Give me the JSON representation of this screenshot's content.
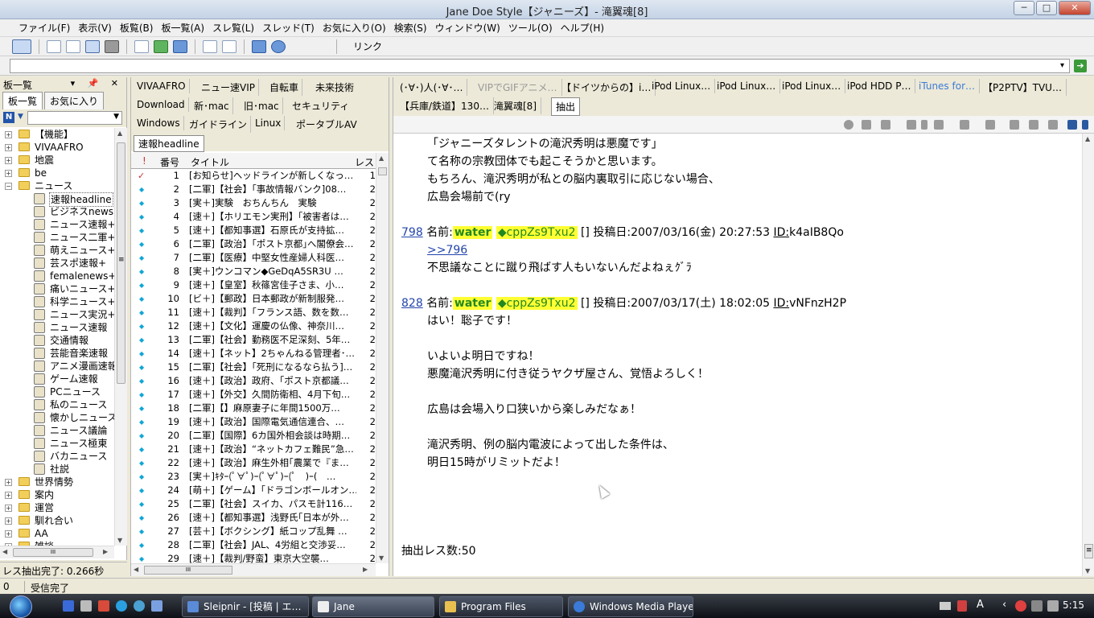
{
  "window": {
    "title": "Jane Doe Style【ジャニーズ】- 滝翼魂[8]",
    "btn_min": "─",
    "btn_max": "□",
    "btn_close": "✕"
  },
  "menu": [
    "ファイル(F)",
    "表示(V)",
    "板覧(B)",
    "板一覧(A)",
    "スレ覧(L)",
    "スレッド(T)",
    "お気に入り(O)",
    "検索(S)",
    "ウィンドウ(W)",
    "ツール(O)",
    "ヘルプ(H)"
  ],
  "toolbar": {
    "link_label": "リンク"
  },
  "address": {
    "value": "",
    "dropdown": "▾",
    "go": "➔"
  },
  "board_pane": {
    "header": "板一覧",
    "controls": "▾ 📌 ✕",
    "tabs": [
      "板一覧",
      "お気に入り"
    ],
    "filter_icon": "N",
    "filter_dd": "▼",
    "filter_box_dd": "▼",
    "tree": [
      {
        "type": "folder",
        "expand": "+",
        "label": "【機能】"
      },
      {
        "type": "folder",
        "expand": "+",
        "label": "VIVAAFRO"
      },
      {
        "type": "folder",
        "expand": "+",
        "label": "地震"
      },
      {
        "type": "folder",
        "expand": "+",
        "label": "be"
      },
      {
        "type": "folder",
        "expand": "−",
        "label": "ニュース"
      },
      {
        "type": "board",
        "label": "速報headline",
        "sel": true
      },
      {
        "type": "board",
        "label": "ビジネスnews+"
      },
      {
        "type": "board",
        "label": "ニュース速報+"
      },
      {
        "type": "board",
        "label": "ニュース二軍+"
      },
      {
        "type": "board",
        "label": "萌えニュース+"
      },
      {
        "type": "board",
        "label": "芸スポ速報+"
      },
      {
        "type": "board",
        "label": "femalenews+"
      },
      {
        "type": "board",
        "label": "痛いニュース+"
      },
      {
        "type": "board",
        "label": "科学ニュース+"
      },
      {
        "type": "board",
        "label": "ニュース実況+"
      },
      {
        "type": "board",
        "label": "ニュース速報"
      },
      {
        "type": "board",
        "label": "交通情報"
      },
      {
        "type": "board",
        "label": "芸能音楽速報"
      },
      {
        "type": "board",
        "label": "アニメ漫画速報"
      },
      {
        "type": "board",
        "label": "ゲーム速報"
      },
      {
        "type": "board",
        "label": "PCニュース"
      },
      {
        "type": "board",
        "label": "私のニュース"
      },
      {
        "type": "board",
        "label": "懐かしニュース"
      },
      {
        "type": "board",
        "label": "ニュース議論"
      },
      {
        "type": "board",
        "label": "ニュース極東"
      },
      {
        "type": "board",
        "label": "バカニュース"
      },
      {
        "type": "board",
        "label": "社説"
      },
      {
        "type": "folder",
        "expand": "+",
        "label": "世界情勢"
      },
      {
        "type": "folder",
        "expand": "+",
        "label": "案内"
      },
      {
        "type": "folder",
        "expand": "+",
        "label": "運営"
      },
      {
        "type": "folder",
        "expand": "+",
        "label": "馴れ合い"
      },
      {
        "type": "folder",
        "expand": "+",
        "label": "AA"
      },
      {
        "type": "folder",
        "expand": "+",
        "label": "雑談"
      }
    ],
    "scroll_grip": "≡",
    "hscroll_grip": "III",
    "arrow_up": "▲",
    "arrow_down": "▼",
    "arrow_left": "◀",
    "arrow_right": "▶",
    "status": "レス抽出完了: 0.266秒"
  },
  "thread_list": {
    "board_buttons": [
      {
        "label": "VIVAAFRO"
      },
      {
        "label": "ニュー速VIP"
      },
      {
        "label": "自転車"
      },
      {
        "label": "未来技術"
      },
      {
        "label": "Download"
      },
      {
        "label": "新･mac"
      },
      {
        "label": "旧･mac"
      },
      {
        "label": "セキュリティ"
      },
      {
        "label": "Windows"
      },
      {
        "label": "ガイドライン"
      },
      {
        "label": "Linux"
      },
      {
        "label": "ポータブルAV"
      }
    ],
    "active_tab": "速報headline",
    "columns": {
      "mark": "!",
      "no": "番号",
      "title": "タイトル",
      "res": "レス"
    },
    "rows": [
      {
        "mark": "✓",
        "no": "1",
        "title": "[お知らせ]ヘッドラインが新しくなっ…",
        "res": "1"
      },
      {
        "mark": "◆",
        "no": "2",
        "title": "[二軍]【社会】｢事故情報バンク]08…",
        "res": "2"
      },
      {
        "mark": "◆",
        "no": "3",
        "title": "[実＋]実験　おちんちん　実験",
        "res": "2"
      },
      {
        "mark": "◆",
        "no": "4",
        "title": "[速＋]【ホリエモン実刑】｢被害者は…",
        "res": "2"
      },
      {
        "mark": "◆",
        "no": "5",
        "title": "[速＋]【都知事選】石原氏が支持拡…",
        "res": "2"
      },
      {
        "mark": "◆",
        "no": "6",
        "title": "[二軍]【政治】｢ポスト京都｣へ閣僚会…",
        "res": "2"
      },
      {
        "mark": "◆",
        "no": "7",
        "title": "[二軍]【医療】中堅女性産婦人科医…",
        "res": "2"
      },
      {
        "mark": "◆",
        "no": "8",
        "title": "[実＋]ウンコマン◆GeDqA5SR3U …",
        "res": "2"
      },
      {
        "mark": "◆",
        "no": "9",
        "title": "[速＋]【皇室】秋篠宮佳子さま、小…",
        "res": "2"
      },
      {
        "mark": "◆",
        "no": "10",
        "title": "[ビ＋]【郵政】日本郵政が新制服発…",
        "res": "2"
      },
      {
        "mark": "◆",
        "no": "11",
        "title": "[速＋]【裁判】｢フランス語、数を数…",
        "res": "2"
      },
      {
        "mark": "◆",
        "no": "12",
        "title": "[速＋]【文化】運慶の仏像、神奈川…",
        "res": "2"
      },
      {
        "mark": "◆",
        "no": "13",
        "title": "[二軍]【社会】勤務医不足深刻、5年…",
        "res": "2"
      },
      {
        "mark": "◆",
        "no": "14",
        "title": "[速＋]【ネット】2ちゃんねる管理者･…",
        "res": "2"
      },
      {
        "mark": "◆",
        "no": "15",
        "title": "[二軍]【社会】｢死刑になるなら払う]…",
        "res": "2"
      },
      {
        "mark": "◆",
        "no": "16",
        "title": "[速＋]【政治】政府、｢ポスト京都議…",
        "res": "2"
      },
      {
        "mark": "◆",
        "no": "17",
        "title": "[速＋]【外交】久間防衛相、4月下旬…",
        "res": "2"
      },
      {
        "mark": "◆",
        "no": "18",
        "title": "[二軍]【】麻原妻子に年間1500万…",
        "res": "2"
      },
      {
        "mark": "◆",
        "no": "19",
        "title": "[速＋]【政治】国際電気通信連合、…",
        "res": "2"
      },
      {
        "mark": "◆",
        "no": "20",
        "title": "[二軍]【国際】6カ国外相会談は時期…",
        "res": "2"
      },
      {
        "mark": "◆",
        "no": "21",
        "title": "[速＋]【政治】“ネットカフェ難民”急…",
        "res": "2"
      },
      {
        "mark": "◆",
        "no": "22",
        "title": "[速＋]【政治】麻生外相｢農業で『ま…",
        "res": "2"
      },
      {
        "mark": "◆",
        "no": "23",
        "title": "[実＋]ｷﾀｰ(ﾟ∀ﾟ)ｰ(ﾟ∀ﾟ)ｰ(ﾟ　)ｰ(　…",
        "res": "2"
      },
      {
        "mark": "◆",
        "no": "24",
        "title": "[萌＋]【ゲーム】｢ドラゴンボールオン…",
        "res": "2"
      },
      {
        "mark": "◆",
        "no": "25",
        "title": "[二軍]【社会】スイカ、パスモ計116…",
        "res": "2"
      },
      {
        "mark": "◆",
        "no": "26",
        "title": "[速＋]【都知事選】浅野氏｢日本が外…",
        "res": "2"
      },
      {
        "mark": "◆",
        "no": "27",
        "title": "[芸＋]【ボクシング】紙コップ乱舞 …",
        "res": "2"
      },
      {
        "mark": "◆",
        "no": "28",
        "title": "[二軍]【社会】JAL、4労組と交渉妥…",
        "res": "2"
      },
      {
        "mark": "◆",
        "no": "29",
        "title": "[速＋]【裁判/野蛮】東京大空襲…",
        "res": "2"
      }
    ],
    "hscroll_grip": "III"
  },
  "viewer": {
    "tabs": [
      {
        "label": "(･∀･)人(･∀･…",
        "style": "normal"
      },
      {
        "label": "VIPでGIFアニメ…",
        "style": "grey"
      },
      {
        "label": "【ドイツからの】i…",
        "style": "normal"
      },
      {
        "label": "iPod Linux…",
        "style": "normal"
      },
      {
        "label": "iPod Linux…",
        "style": "normal"
      },
      {
        "label": "iPod Linux…",
        "style": "normal"
      },
      {
        "label": "iPod HDD P…",
        "style": "normal"
      },
      {
        "label": "iTunes for…",
        "style": "blue"
      },
      {
        "label": "【P2PTV】TVU…",
        "style": "normal"
      },
      {
        "label": "【兵庫/鉄道】130…",
        "style": "normal"
      },
      {
        "label": "滝翼魂[8]",
        "style": "normal"
      },
      {
        "label": "抽出",
        "style": "active"
      }
    ],
    "pre_lines": [
      "「ジャニーズタレントの滝沢秀明は悪魔です」",
      "て名称の宗教団体でも起こそうかと思います。",
      "もちろん、滝沢秀明が私との脳内裏取引に応じない場合、",
      "広島会場前で(ry"
    ],
    "posts": [
      {
        "num": "798",
        "name_label": "名前:",
        "name": "water",
        "trip": "◆cppZs9Txu2",
        "mail": "[]",
        "date_label": "投稿日:",
        "date": "2007/03/16(金) 20:27:53",
        "id_label": "ID:",
        "id": "k4aIB8Qo",
        "body": [
          ">>796",
          "不思議なことに蹴り飛ばす人もいないんだよねぇｸﾞﾗ"
        ]
      },
      {
        "num": "828",
        "name_label": "名前:",
        "name": "water",
        "trip": "◆cppZs9Txu2",
        "mail": "[]",
        "date_label": "投稿日:",
        "date": "2007/03/17(土) 18:02:05",
        "id_label": "ID:",
        "id": "vNFnzH2P",
        "body": [
          "はい！聡子です！",
          "",
          "いよいよ明日ですね！",
          "悪魔滝沢秀明に付き従うヤクザ屋さん、覚悟よろしく！",
          "",
          "広島は会場入り口狭いから楽しみだなぁ！",
          "",
          "滝沢秀明、例の脳内電波によって出した条件は、",
          "明日15時がリミットだよ！"
        ]
      }
    ],
    "footer": "抽出レス数:50",
    "scroll_grip": "≡"
  },
  "statusbar": {
    "left": "0",
    "right": "受信完了"
  },
  "taskbar": {
    "tasks": [
      "Sleipnir - [投稿 | エ…",
      "Jane",
      "Program Files",
      "Windows Media Player"
    ],
    "clock": "5:15",
    "tray_ime": "A"
  }
}
